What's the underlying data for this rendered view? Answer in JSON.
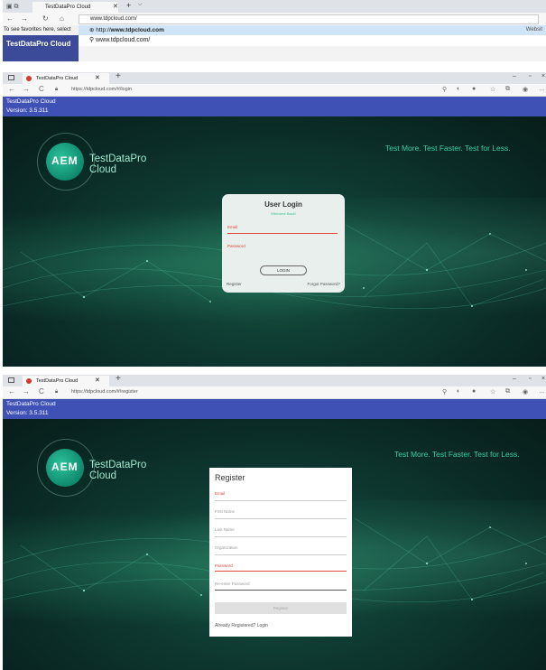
{
  "shot1": {
    "tab_title": "TestDataPro Cloud",
    "tab_close": "✕",
    "new_tab": "+",
    "tab_menu": "⌵",
    "address": "www.tdpcloud.com/",
    "favorites_hint": "To see favorites here, select",
    "suggestion_primary": "http://www.tdpcloud.com",
    "suggestion_primary_prefix": "http://",
    "suggestion_primary_host": "www.tdpcloud.com",
    "suggestion_secondary": "www.tdpcloud.com/",
    "suggestion_right": "Websit",
    "app_bar_text": "TestDataPro Cloud"
  },
  "shot2": {
    "tab_title": "TestDataPro Cloud",
    "url": "https://tdpcloud.com/#/login",
    "app_name": "TestDataPro Cloud",
    "version": "Version: 3.5.311",
    "logo": "AEM",
    "brand_line1": "TestDataPro",
    "brand_line2": "Cloud",
    "tagline": "Test More. Test Faster. Test for Less.",
    "login": {
      "title": "User Login",
      "subtitle": "Welcome Back!",
      "email_label": "Email",
      "password_label": "Password",
      "button": "LOGIN",
      "register_link": "Register",
      "forgot_link": "Forgot Password?"
    }
  },
  "shot3": {
    "tab_title": "TestDataPro Cloud",
    "url": "https://tdpcloud.com/#/register",
    "app_name": "TestDataPro Cloud",
    "version": "Version: 3.5.311",
    "logo": "AEM",
    "brand_line1": "TestDataPro",
    "brand_line2": "Cloud",
    "tagline": "Test More. Test Faster. Test for Less.",
    "register": {
      "title": "Register",
      "email_label": "Email",
      "first_name_label": "First Name",
      "last_name_label": "Last Name",
      "organization_label": "Organization",
      "password_label": "Password",
      "reenter_password_label": "Re-enter Password",
      "button": "Register",
      "already_text": "Already Registered?",
      "login_link": "Login"
    }
  },
  "colors": {
    "app_bar": "#3f51b5",
    "accent_green": "#39d0a2",
    "error_red": "#e0463c"
  },
  "icons": [
    "back-icon",
    "forward-icon",
    "refresh-icon",
    "home-icon",
    "lock-icon",
    "star-icon",
    "extension-icon",
    "profile-icon",
    "more-icon"
  ]
}
